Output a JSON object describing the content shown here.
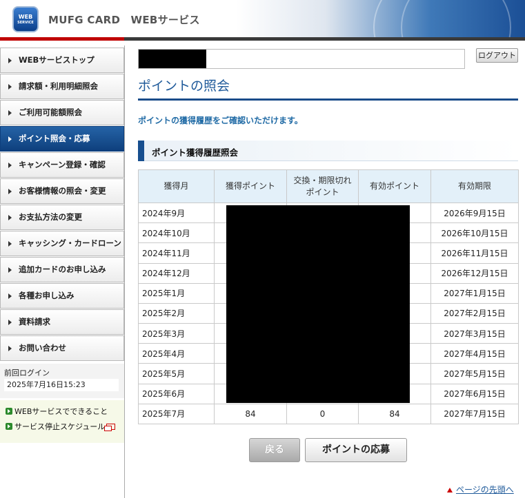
{
  "header": {
    "logo_text": "WEB",
    "logo_sub": "SERVICE",
    "brand": "MUFG CARD　WEBサービス"
  },
  "user": {
    "logout_label": "ログアウト"
  },
  "sidebar": {
    "items": [
      {
        "label": "WEBサービストップ",
        "active": false
      },
      {
        "label": "請求額・利用明細照会",
        "active": false
      },
      {
        "label": "ご利用可能額照会",
        "active": false
      },
      {
        "label": "ポイント照会・応募",
        "active": true
      },
      {
        "label": "キャンペーン登録・確認",
        "active": false
      },
      {
        "label": "お客様情報の照会・変更",
        "active": false
      },
      {
        "label": "お支払方法の変更",
        "active": false
      },
      {
        "label": "キャッシング・カードローン",
        "active": false
      },
      {
        "label": "追加カードのお申し込み",
        "active": false
      },
      {
        "label": "各種お申し込み",
        "active": false
      },
      {
        "label": "資料請求",
        "active": false
      },
      {
        "label": "お問い合わせ",
        "active": false
      }
    ],
    "last_login_label": "前回ログイン",
    "last_login_value": "2025年7月16日15:23",
    "links": [
      "WEBサービスでできること",
      "サービス停止スケジュール"
    ]
  },
  "main": {
    "title": "ポイントの照会",
    "intro": "ポイントの獲得履歴をご確認いただけます。",
    "section_title": "ポイント獲得履歴照会",
    "table": {
      "headers": [
        "獲得月",
        "獲得ポイント",
        "交換・期限切れ\nポイント",
        "有効ポイント",
        "有効期限"
      ],
      "rows": [
        [
          "2024年9月",
          "",
          "",
          "",
          "2026年9月15日"
        ],
        [
          "2024年10月",
          "",
          "",
          "",
          "2026年10月15日"
        ],
        [
          "2024年11月",
          "",
          "",
          "",
          "2026年11月15日"
        ],
        [
          "2024年12月",
          "",
          "",
          "",
          "2026年12月15日"
        ],
        [
          "2025年1月",
          "",
          "",
          "",
          "2027年1月15日"
        ],
        [
          "2025年2月",
          "",
          "",
          "",
          "2027年2月15日"
        ],
        [
          "2025年3月",
          "",
          "",
          "",
          "2027年3月15日"
        ],
        [
          "2025年4月",
          "",
          "",
          "",
          "2027年4月15日"
        ],
        [
          "2025年5月",
          "",
          "",
          "",
          "2027年5月15日"
        ],
        [
          "2025年6月",
          "",
          "",
          "",
          "2027年6月15日"
        ],
        [
          "2025年7月",
          "84",
          "0",
          "84",
          "2027年7月15日"
        ]
      ]
    },
    "back_label": "戻る",
    "apply_label": "ポイントの応募",
    "page_top_label": "ページの先頭へ"
  },
  "colors": {
    "accent": "#1f5a9a",
    "active_nav": "#174f8f",
    "header_red": "#c00000"
  }
}
